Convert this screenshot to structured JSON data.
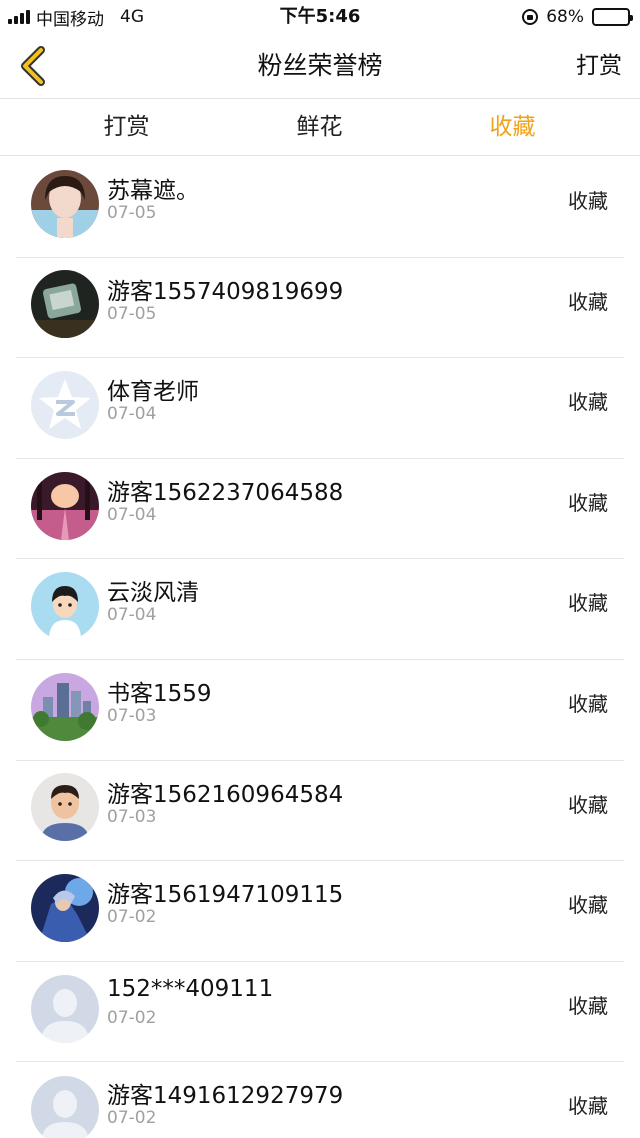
{
  "status_bar": {
    "carrier": "中国移动",
    "network": "4G",
    "time": "下午5:46",
    "battery_percent": "68%",
    "battery_level": 0.68
  },
  "nav": {
    "title": "粉丝荣誉榜",
    "action_label": "打赏",
    "back_icon": "chevron-left-icon",
    "accent_color": "#f0a31a"
  },
  "tabs": [
    {
      "label": "打赏",
      "active": false
    },
    {
      "label": "鲜花",
      "active": false
    },
    {
      "label": "收藏",
      "active": true
    }
  ],
  "fans": [
    {
      "name": "苏幕遮。",
      "date": "07-05",
      "action": "收藏",
      "avatar": "photo-avatar"
    },
    {
      "name": "游客1557409819699",
      "date": "07-05",
      "action": "收藏",
      "avatar": "dark-photo-avatar"
    },
    {
      "name": "体育老师",
      "date": "07-04",
      "action": "收藏",
      "avatar": "qzone-star-avatar"
    },
    {
      "name": "游客1562237064588",
      "date": "07-04",
      "action": "收藏",
      "avatar": "pink-forest-avatar"
    },
    {
      "name": "云淡风清",
      "date": "07-04",
      "action": "收藏",
      "avatar": "cartoon-boy-avatar"
    },
    {
      "name": "书客1559",
      "date": "07-03",
      "action": "收藏",
      "avatar": "city-skyline-avatar"
    },
    {
      "name": "游客1562160964584",
      "date": "07-03",
      "action": "收藏",
      "avatar": "child-photo-avatar"
    },
    {
      "name": "游客1561947109115",
      "date": "07-02",
      "action": "收藏",
      "avatar": "game-character-avatar"
    },
    {
      "name": "152***409111",
      "date": "07-02",
      "action": "收藏",
      "avatar": "default-user-avatar"
    },
    {
      "name": "游客1491612927979",
      "date": "07-02",
      "action": "收藏",
      "avatar": "default-user-avatar"
    }
  ]
}
